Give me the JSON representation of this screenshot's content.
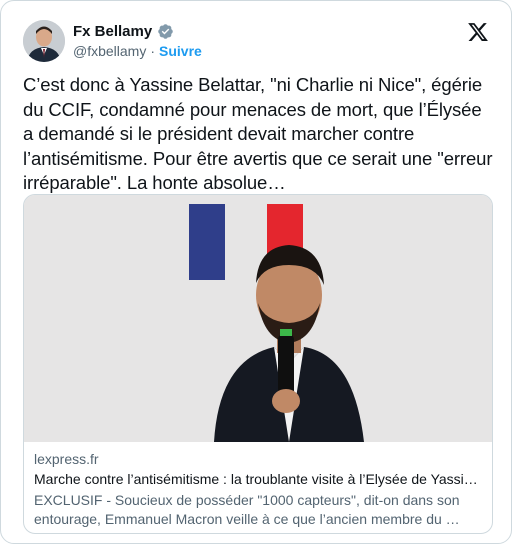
{
  "author": {
    "name": "Fx Bellamy",
    "handle": "@fxbellamy",
    "separator": "·",
    "follow_label": "Suivre"
  },
  "icons": {
    "verified": "verified-badge-icon",
    "brand": "x-logo-icon"
  },
  "colors": {
    "accent": "#1d9bf0",
    "secondary_text": "#536471",
    "border": "#cfd9de"
  },
  "tweet": {
    "text": "C’est donc à Yassine Belattar, \"ni Charlie ni Nice\", égérie du CCIF, condamné pour menaces de mort, que l’Élysée a demandé si le président devait marcher contre l’antisémitisme. Pour être avertis que ce serait une \"erreur irréparable\". La honte absolue…"
  },
  "link_card": {
    "domain": "lexpress.fr",
    "title": "Marche contre l’antisémitisme : la troublante visite à l’Elysée de Yassi…",
    "description": "EXCLUSIF - Soucieux de posséder \"1000 capteurs\", dit-on dans son entourage, Emmanuel Macron veille à ce que l’ancien membre du …"
  }
}
